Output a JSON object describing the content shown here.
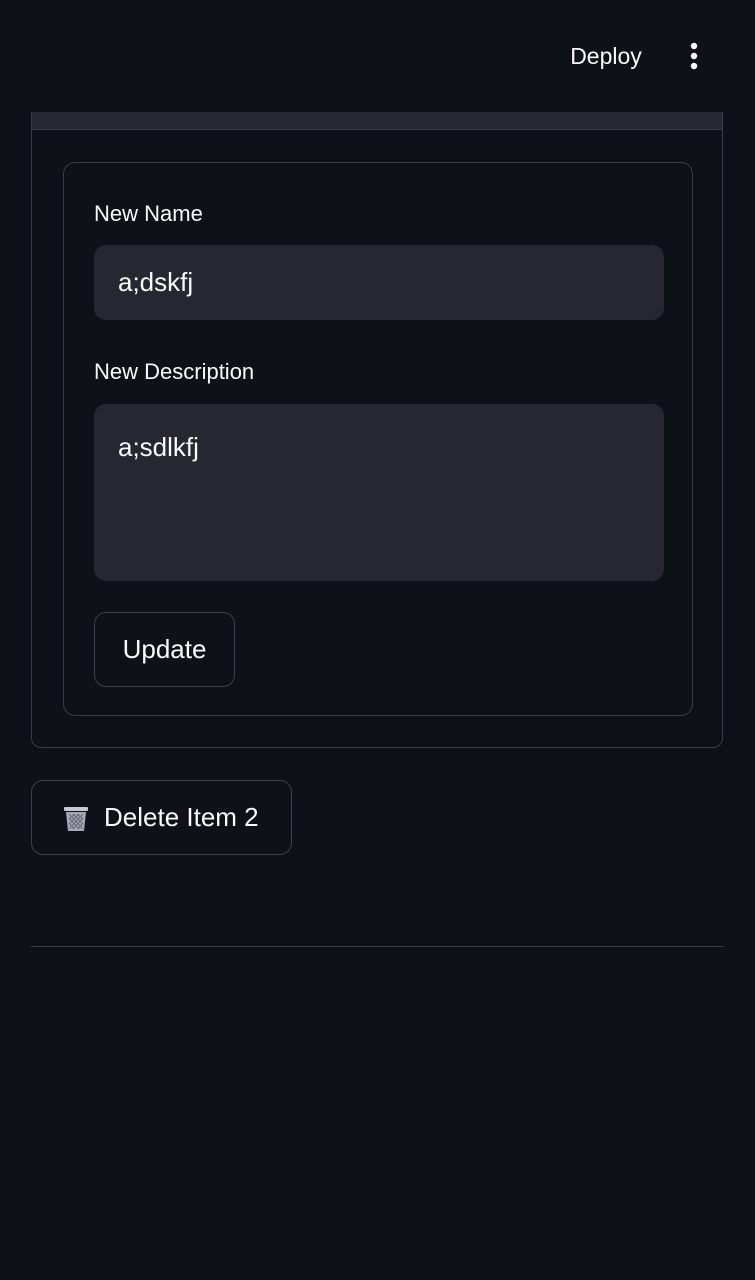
{
  "header": {
    "deploy_label": "Deploy",
    "menu_icon": "kebab-vertical-icon"
  },
  "form": {
    "name_label": "New Name",
    "name_value": "a;dskfj",
    "description_label": "New Description",
    "description_value": "a;sdlkfj",
    "update_label": "Update"
  },
  "delete": {
    "icon": "wastebasket-icon",
    "label": "Delete Item 2"
  },
  "colors": {
    "background": "#0e1117",
    "input_background": "#262730",
    "border": "#3a3d46",
    "text": "#fafafa"
  }
}
